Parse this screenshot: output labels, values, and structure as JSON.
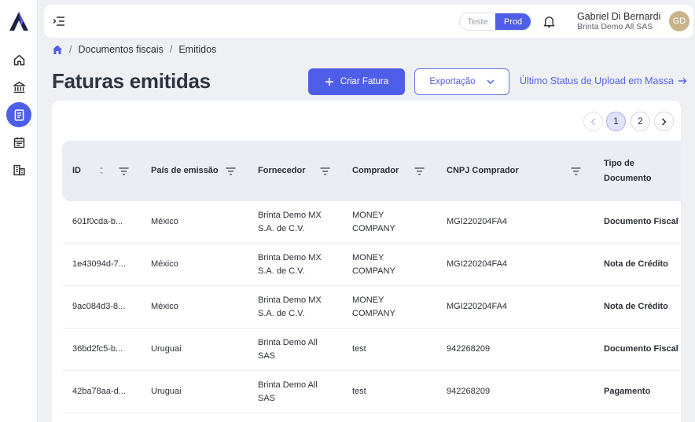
{
  "sidebar": {
    "logo": "brinta-logo",
    "items": [
      {
        "icon": "home-icon"
      },
      {
        "icon": "bank-icon"
      },
      {
        "icon": "invoice-icon"
      },
      {
        "icon": "calendar-icon"
      },
      {
        "icon": "buildings-icon"
      }
    ],
    "active_color": "#4f5ee8"
  },
  "topbar": {
    "env_options": [
      "Teste",
      "Prod"
    ],
    "env_selected": "Prod",
    "user_name": "Gabriel Di Bernardi",
    "user_org": "Brinta Demo All SAS",
    "avatar_initials": "GD"
  },
  "breadcrumb": {
    "items": [
      "Documentos fiscais",
      "Emitidos"
    ],
    "separator": "/"
  },
  "page": {
    "title": "Faturas emitidas",
    "create_button": "Criar Fatura",
    "export_button": "Exportação",
    "upload_status_link": "Último Status de Upload em Massa",
    "accent": "#4f5ee8"
  },
  "pagination": {
    "pages": [
      "1",
      "2"
    ],
    "current": "1"
  },
  "table": {
    "columns": [
      "ID",
      "País de emissão",
      "Fornecedor",
      "Comprador",
      "CNPJ Comprador",
      "Tipo de Documento"
    ],
    "rows": [
      {
        "id": "601f0cda-b...",
        "country": "México",
        "supplier": [
          "Brinta Demo MX",
          "S.A. de C.V."
        ],
        "buyer": [
          "MONEY",
          "COMPANY"
        ],
        "cnpj": "MGI220204FA4",
        "doc_type": "Documento Fiscal"
      },
      {
        "id": "1e43094d-7...",
        "country": "México",
        "supplier": [
          "Brinta Demo MX",
          "S.A. de C.V."
        ],
        "buyer": [
          "MONEY",
          "COMPANY"
        ],
        "cnpj": "MGI220204FA4",
        "doc_type": "Nota de Crédito"
      },
      {
        "id": "9ac084d3-8...",
        "country": "México",
        "supplier": [
          "Brinta Demo MX",
          "S.A. de C.V."
        ],
        "buyer": [
          "MONEY",
          "COMPANY"
        ],
        "cnpj": "MGI220204FA4",
        "doc_type": "Nota de Crédito"
      },
      {
        "id": "36bd2fc5-b...",
        "country": "Uruguai",
        "supplier": [
          "Brinta Demo All",
          "SAS"
        ],
        "buyer": [
          "test"
        ],
        "cnpj": "942268209",
        "doc_type": "Documento Fiscal"
      },
      {
        "id": "42ba78aa-d...",
        "country": "Uruguai",
        "supplier": [
          "Brinta Demo All",
          "SAS"
        ],
        "buyer": [
          "test"
        ],
        "cnpj": "942268209",
        "doc_type": "Pagamento"
      }
    ]
  }
}
